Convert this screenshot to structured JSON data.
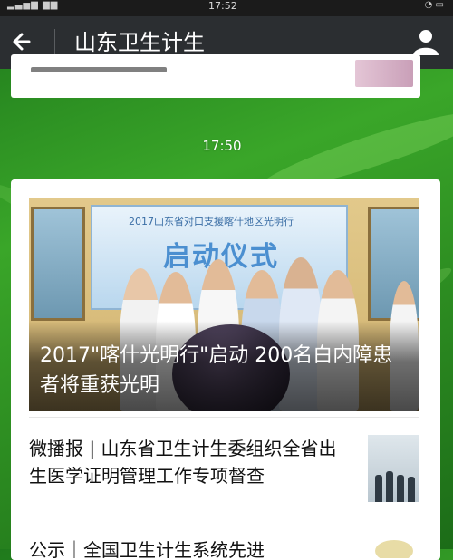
{
  "status_bar": {
    "time": "17:52"
  },
  "header": {
    "title": "山东卫生计生"
  },
  "timestamp": "17:50",
  "hero": {
    "caption": "2017\"喀什光明行\"启动 200名白内障患者将重获光明",
    "banner_main": "启动仪式",
    "banner_top": "2017山东省对口支援喀什地区光明行"
  },
  "articles": [
    {
      "title": "微播报 | 山东省卫生计生委组织全省出生医学证明管理工作专项督查"
    },
    {
      "title": "公示｜全国卫生计生系统先进"
    }
  ],
  "colors": {
    "header_bg": "#2b2e31",
    "card_bg": "#ffffff",
    "wallpaper": "#2e8f22"
  }
}
